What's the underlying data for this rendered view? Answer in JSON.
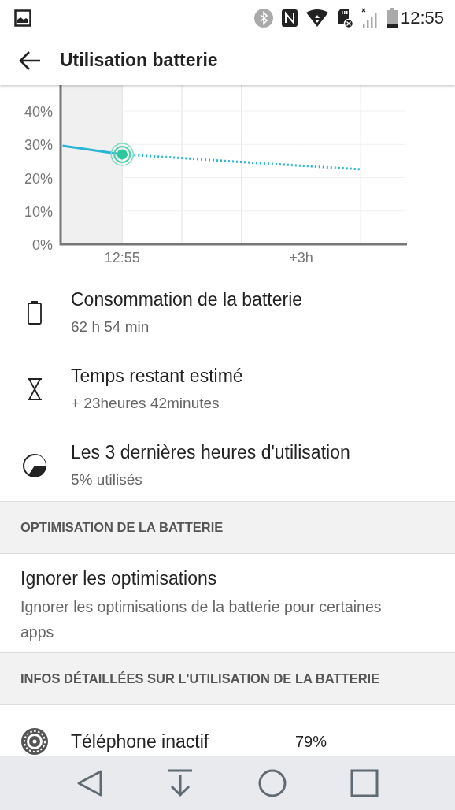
{
  "status_bar": {
    "time": "12:55"
  },
  "app_bar": {
    "title": "Utilisation batterie"
  },
  "chart": {
    "chart_data": {
      "type": "line",
      "grid": true,
      "categories": [
        null,
        "12:55",
        null,
        null,
        "+3h",
        null
      ],
      "ylim": [
        0,
        40
      ],
      "yticks": [
        {
          "value": 0,
          "label": "0%"
        },
        {
          "value": 10,
          "label": "10%"
        },
        {
          "value": 20,
          "label": "20%"
        },
        {
          "value": 30,
          "label": "30%"
        },
        {
          "value": 40,
          "label": "40%"
        }
      ],
      "series": [
        {
          "color": "#29b6d6",
          "line_style": "solid",
          "values": [
            29.6,
            27,
            null,
            null,
            null,
            null
          ]
        },
        {
          "color": "#29b6d6",
          "line_style": "dotted",
          "values": [
            null,
            27,
            25.9,
            24.7,
            23.6,
            22.5
          ]
        }
      ]
    }
  },
  "usage_items": [
    {
      "kind": "battery",
      "title": "Consommation de la batterie",
      "subtitle": "62 h 54 min"
    },
    {
      "kind": "hourglass",
      "title": "Temps restant estimé",
      "subtitle": "+ 23heures 42minutes"
    },
    {
      "kind": "halfcircle",
      "title": "Les 3 dernières heures d'utilisation",
      "subtitle": "5% utilisés"
    }
  ],
  "optimisation": {
    "header": "OPTIMISATION DE LA BATTERIE",
    "item": {
      "title": "Ignorer les optimisations",
      "summary": "Ignorer les optimisations de la batterie pour certaines apps"
    }
  },
  "details": {
    "header": "INFOS DÉTAILLÉES SUR L'UTILISATION DE LA BATTERIE",
    "rows": [
      {
        "name": "Téléphone inactif",
        "percent": "79%"
      }
    ]
  }
}
